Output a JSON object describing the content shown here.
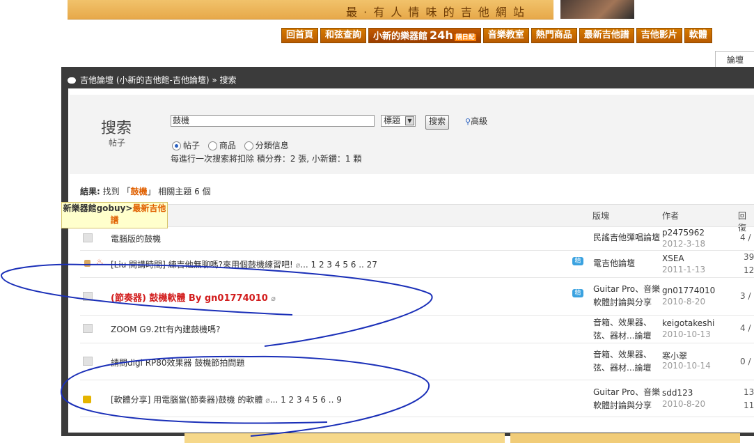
{
  "banner": {
    "text": "最 · 有 人 情 味 的 吉 他 網 站"
  },
  "menu": {
    "items": [
      "回首頁",
      "和弦查詢",
      "小新的樂器館",
      "音樂教室",
      "熱門商品",
      "最新吉他譜",
      "吉他影片",
      "軟體"
    ],
    "store_badge": "24h",
    "store_small": "隔日配"
  },
  "tab": {
    "label": "論壇"
  },
  "breadcrumb": {
    "text": "吉他論壇 (小新的吉他館-吉他論壇) » 搜索"
  },
  "search": {
    "title": "搜索",
    "subtitle": "帖子",
    "query": "鼓機",
    "scope": "標題",
    "button": "搜索",
    "advanced": "高級",
    "types": [
      "帖子",
      "商品",
      "分類信息"
    ],
    "cost_note": "每進行一次搜索將扣除 積分券：2 張, 小新鑽：1 顆"
  },
  "result": {
    "prefix": "結果:",
    "found": "找到 「",
    "keyword": "鼓機",
    "suffix": "」 相關主題 6 個"
  },
  "table": {
    "headers": {
      "forum": "版塊",
      "author": "作者",
      "replies": "回復"
    },
    "rows": [
      {
        "title": "電腦版的鼓機",
        "pages": "",
        "forum1": "民謠吉他彈唱論壇",
        "forum2": "",
        "author": "p2475962",
        "date": "2012-3-18",
        "rep1": "4 /",
        "rep2": ""
      },
      {
        "title": "[Liu 開講時間] 練吉他無聊嗎?來用個鼓機練習吧!",
        "pages": "... 1 2 3 4 5 6 .. 27",
        "forum1": "電吉他論壇",
        "forum2": "",
        "author": "XSEA",
        "date": "2011-1-13",
        "rep1": "39",
        "rep2": "12"
      },
      {
        "title": "(節奏器) 鼓機軟體 By gn01774010",
        "pages": "",
        "forum1": "Guitar Pro、音樂",
        "forum2": "軟體討論與分享",
        "author": "gn01774010",
        "date": "2010-8-20",
        "rep1": "3 /",
        "rep2": ""
      },
      {
        "title": "ZOOM G9.2tt有內建鼓機嗎?",
        "pages": "",
        "forum1": "音箱、效果器、",
        "forum2": "弦、器材...論壇",
        "author": "keigotakeshi",
        "date": "2010-10-13",
        "rep1": "4 /",
        "rep2": ""
      },
      {
        "title": "請問digi RP80效果器 鼓機節拍問題",
        "pages": "",
        "forum1": "音箱、效果器、",
        "forum2": "弦、器材...論壇",
        "author": "寒小翠",
        "date": "2010-10-14",
        "rep1": "0 /",
        "rep2": ""
      },
      {
        "title": "[軟體分享] 用電腦當(節奏器)鼓機 的軟體",
        "pages": "... 1 2 3 4 5 6 .. 9",
        "forum1": "Guitar Pro、音樂",
        "forum2": "軟體討論與分享",
        "author": "sdd123",
        "date": "2010-8-20",
        "rep1": "13",
        "rep2": "11"
      }
    ],
    "hot_badge": "精"
  },
  "tooltip": {
    "line1a": "新樂器館gobuy>",
    "line1b": "最新吉他",
    "line2": "譜"
  },
  "colors": {
    "menu": "#c96a00",
    "panel": "#3b3b3b",
    "accent": "#e06000",
    "annotation": "#1a2fb8"
  }
}
